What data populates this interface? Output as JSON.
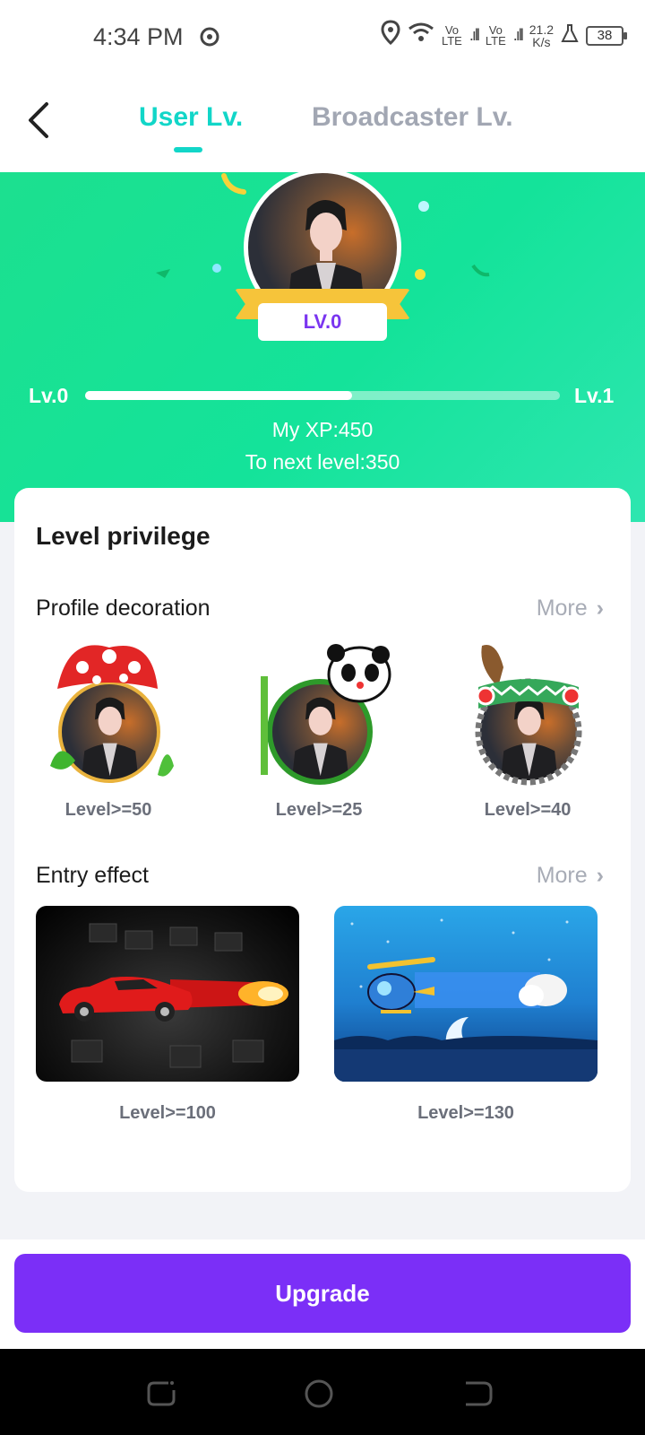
{
  "status_bar": {
    "time": "4:34 PM",
    "sim1": "Vo\nLTE",
    "sim2": "Vo\nLTE",
    "speed_value": "21.2",
    "speed_unit": "K/s",
    "battery": "38"
  },
  "header": {
    "tabs": [
      {
        "label": "User Lv.",
        "active": true
      },
      {
        "label": "Broadcaster Lv.",
        "active": false
      }
    ]
  },
  "hero": {
    "badge": "LV.0",
    "current_level": "Lv.0",
    "next_level": "Lv.1",
    "xp_text": "My XP:450",
    "to_next_text": "To next level:350",
    "progress_fraction": 0.5625
  },
  "privilege": {
    "title": "Level privilege",
    "profile_decoration": {
      "title": "Profile decoration",
      "more": "More",
      "items": [
        {
          "label": "Level>=50",
          "icon": "mushroom-frame-icon"
        },
        {
          "label": "Level>=25",
          "icon": "panda-bamboo-frame-icon"
        },
        {
          "label": "Level>=40",
          "icon": "frog-feather-frame-icon"
        }
      ]
    },
    "entry_effect": {
      "title": "Entry effect",
      "more": "More",
      "items": [
        {
          "label": "Level>=100",
          "icon": "red-sports-car-icon"
        },
        {
          "label": "Level>=130",
          "icon": "helicopter-moon-icon"
        }
      ]
    }
  },
  "actions": {
    "upgrade_label": "Upgrade"
  },
  "colors": {
    "accent_tab": "#12d6c8",
    "hero_green": "#1ce08f",
    "upgrade_purple": "#7b2ff7",
    "badge_purple": "#7a35f0"
  }
}
